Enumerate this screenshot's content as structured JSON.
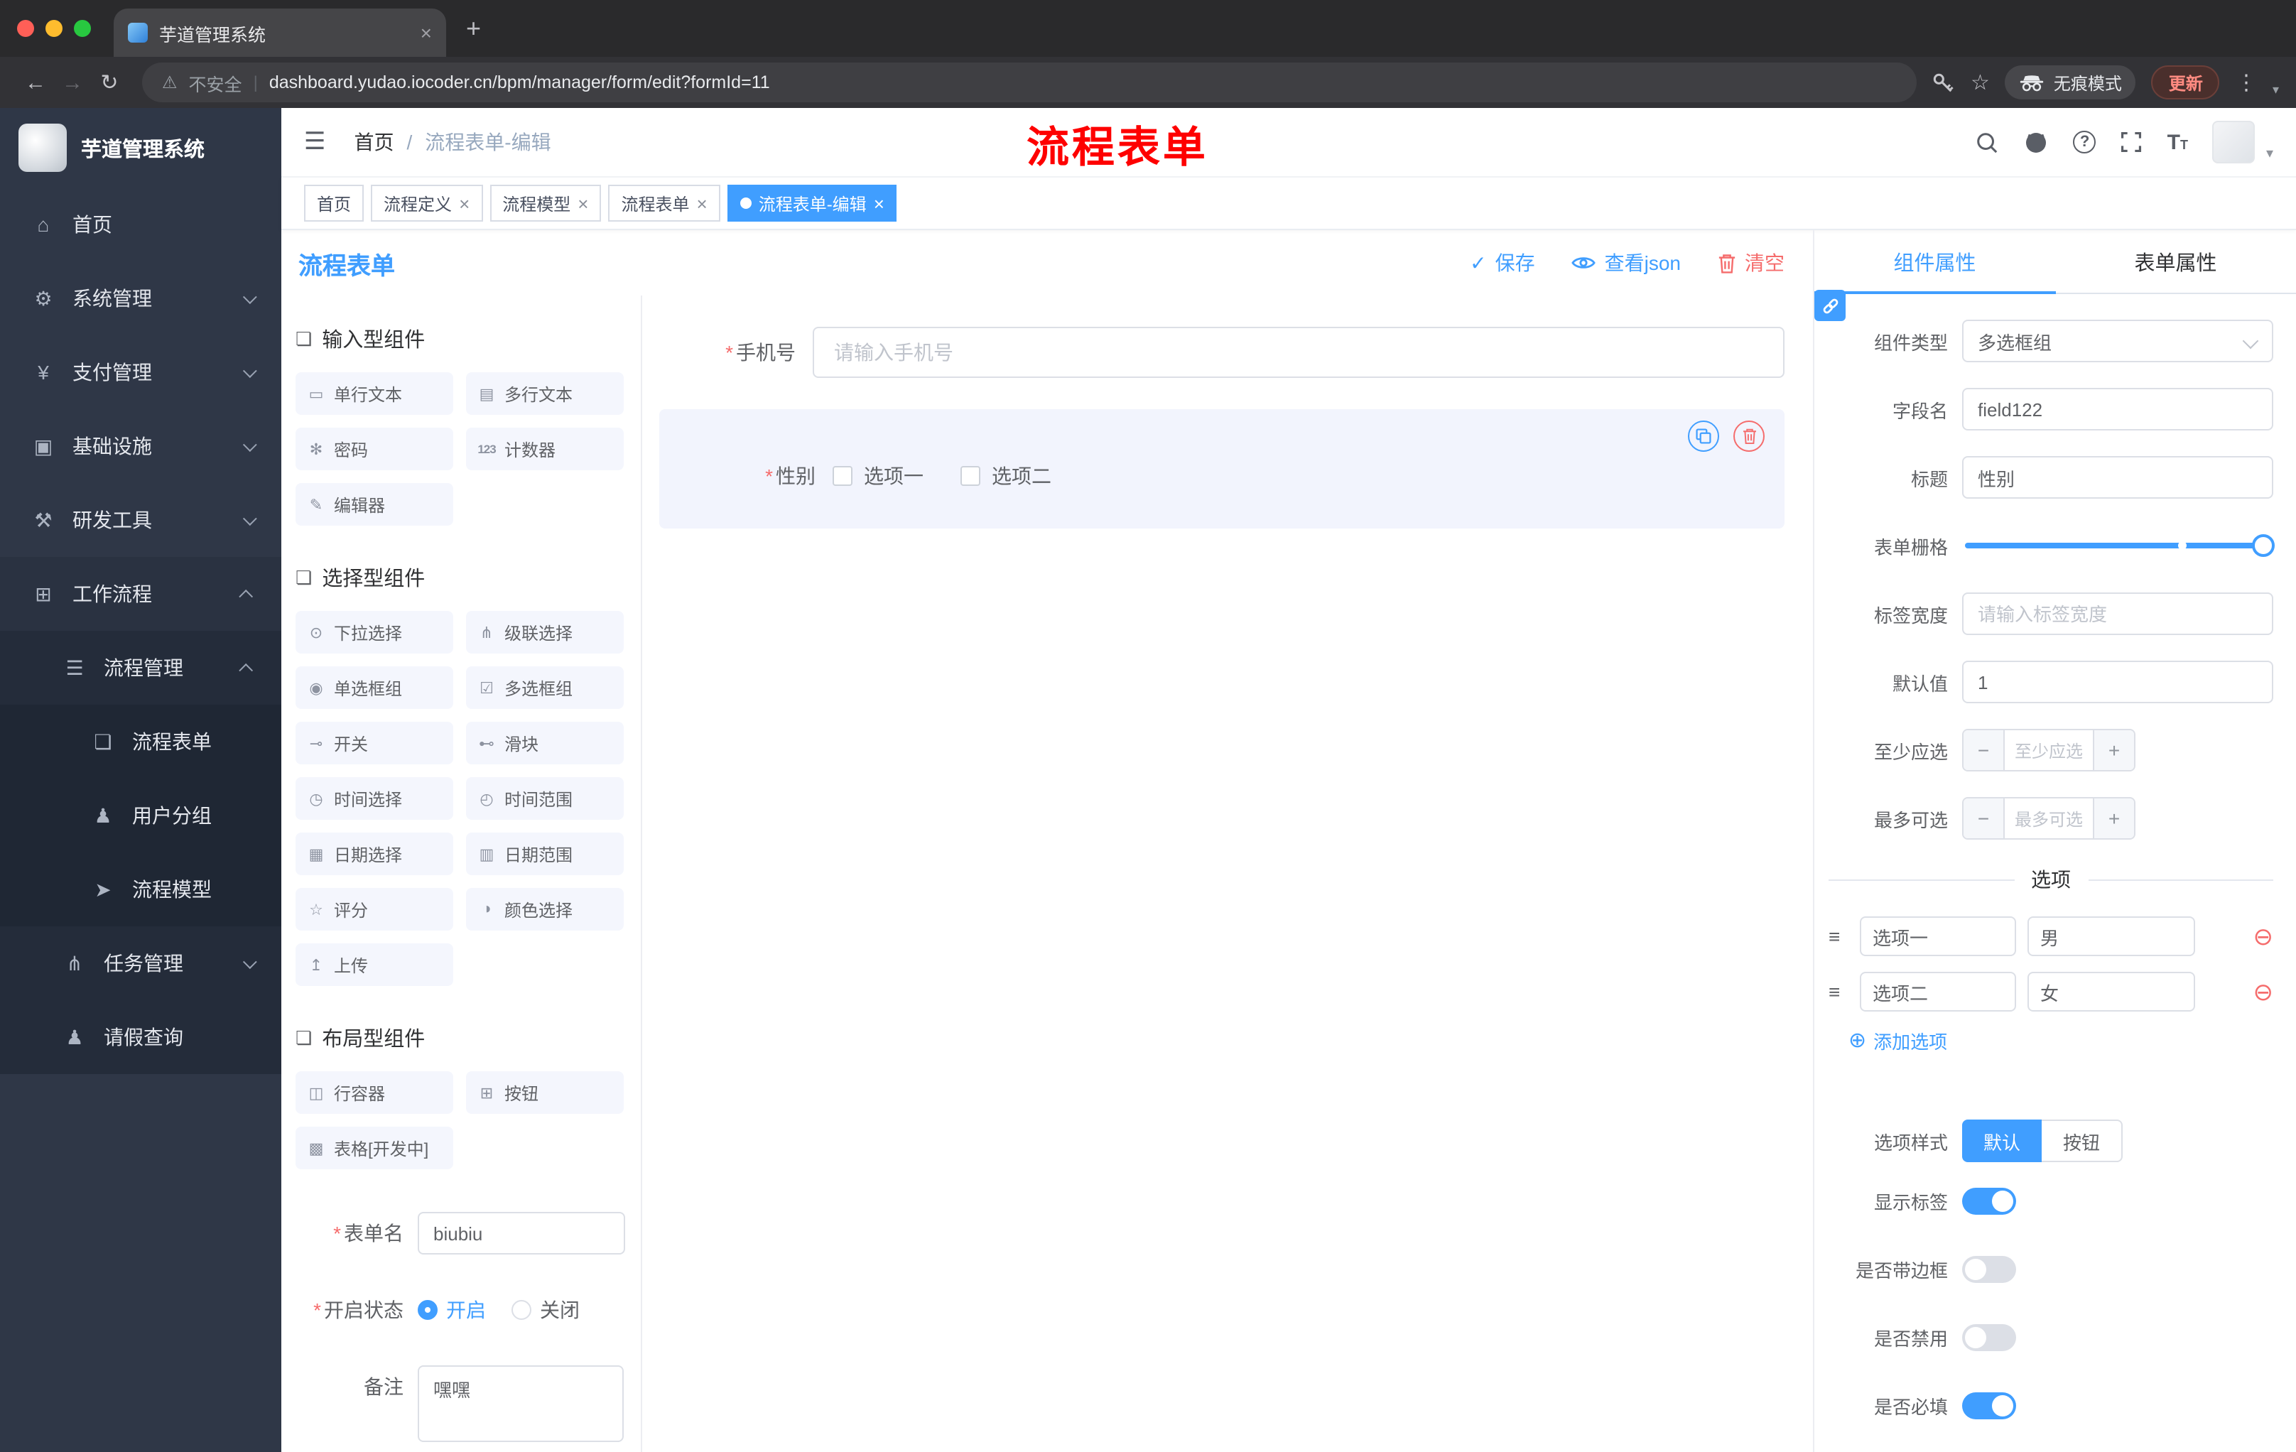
{
  "ui": {
    "close": "×",
    "plus": "+",
    "minus": "−",
    "back": "←",
    "forward": "→",
    "reload": "↻",
    "kebab": "⋮",
    "star": "☆",
    "warning": "⚠",
    "divider": "|",
    "hamburger": "☰",
    "caret": "▾",
    "check": "✓",
    "required": "*",
    "breadcrumb_sep": "/",
    "drag": "≡",
    "remove": "⊖",
    "add": "⊕"
  },
  "colors": {
    "accent": "#409EFF",
    "danger": "#F56C6C",
    "annotation": "#FE0000",
    "sidebar_bg": "#2F3747",
    "tag_active": "#409EFF"
  },
  "browser": {
    "tab_title": "芋道管理系统",
    "security_label": "不安全",
    "url": "dashboard.yudao.iocoder.cn/bpm/manager/form/edit?formId=11",
    "incognito_label": "无痕模式",
    "update_label": "更新"
  },
  "header": {
    "breadcrumb_home": "首页",
    "breadcrumb_current": "流程表单-编辑",
    "annotation": "流程表单"
  },
  "sidebar": {
    "logo_title": "芋道管理系统",
    "items": [
      {
        "label": "首页",
        "icon": "⌂"
      },
      {
        "label": "系统管理",
        "icon": "⚙"
      },
      {
        "label": "支付管理",
        "icon": "¥"
      },
      {
        "label": "基础设施",
        "icon": "▣"
      },
      {
        "label": "研发工具",
        "icon": "⚒"
      },
      {
        "label": "工作流程",
        "icon": "⊞"
      },
      {
        "label": "流程管理",
        "icon": "☰"
      },
      {
        "label": "流程表单",
        "icon": "❏"
      },
      {
        "label": "用户分组",
        "icon": "♟"
      },
      {
        "label": "流程模型",
        "icon": "➤"
      },
      {
        "label": "任务管理",
        "icon": "⋔"
      },
      {
        "label": "请假查询",
        "icon": "♟"
      }
    ]
  },
  "tags": {
    "items": [
      {
        "label": "首页"
      },
      {
        "label": "流程定义"
      },
      {
        "label": "流程模型"
      },
      {
        "label": "流程表单"
      },
      {
        "label": "流程表单-编辑"
      }
    ]
  },
  "page": {
    "title": "流程表单",
    "actions": {
      "save": "保存",
      "view_json": "查看json",
      "clear": "清空"
    }
  },
  "palette": {
    "groups": [
      {
        "title": "输入型组件",
        "icon": "❏",
        "items": [
          {
            "label": "单行文本",
            "icon": "▭"
          },
          {
            "label": "多行文本",
            "icon": "▤"
          },
          {
            "label": "密码",
            "icon": "✻"
          },
          {
            "label": "计数器",
            "icon": "123"
          },
          {
            "label": "编辑器",
            "icon": "✎"
          }
        ]
      },
      {
        "title": "选择型组件",
        "icon": "❏",
        "items": [
          {
            "label": "下拉选择",
            "icon": "⊙"
          },
          {
            "label": "级联选择",
            "icon": "⋔"
          },
          {
            "label": "单选框组",
            "icon": "◉"
          },
          {
            "label": "多选框组",
            "icon": "☑"
          },
          {
            "label": "开关",
            "icon": "⊸"
          },
          {
            "label": "滑块",
            "icon": "⊷"
          },
          {
            "label": "时间选择",
            "icon": "◷"
          },
          {
            "label": "时间范围",
            "icon": "◴"
          },
          {
            "label": "日期选择",
            "icon": "▦"
          },
          {
            "label": "日期范围",
            "icon": "▥"
          },
          {
            "label": "评分",
            "icon": "☆"
          },
          {
            "label": "颜色选择",
            "icon": "◑"
          },
          {
            "label": "上传",
            "icon": "↥"
          }
        ]
      },
      {
        "title": "布局型组件",
        "icon": "❏",
        "items": [
          {
            "label": "行容器",
            "icon": "◫"
          },
          {
            "label": "按钮",
            "icon": "⊞"
          },
          {
            "label": "表格[开发中]",
            "icon": "▩"
          }
        ]
      }
    ]
  },
  "form_settings": {
    "name_label": "表单名",
    "name_value": "biubiu",
    "status_label": "开启状态",
    "status_on": "开启",
    "status_off": "关闭",
    "remark_label": "备注",
    "remark_value": "嘿嘿"
  },
  "canvas": {
    "phone_label": "手机号",
    "phone_placeholder": "请输入手机号",
    "gender_label": "性别",
    "gender_options": [
      "选项一",
      "选项二"
    ]
  },
  "props": {
    "tabs": {
      "component": "组件属性",
      "form": "表单属性"
    },
    "fields": {
      "type_label": "组件类型",
      "type_value": "多选框组",
      "name_label": "字段名",
      "name_value": "field122",
      "title_label": "标题",
      "title_value": "性别",
      "grid_label": "表单栅格",
      "label_width_label": "标签宽度",
      "label_width_placeholder": "请输入标签宽度",
      "default_label": "默认值",
      "default_value": "1",
      "min_label": "至少应选",
      "min_placeholder": "至少应选",
      "max_label": "最多可选",
      "max_placeholder": "最多可选"
    },
    "options_divider": "选项",
    "options": [
      {
        "label": "选项一",
        "value": "男"
      },
      {
        "label": "选项二",
        "value": "女"
      }
    ],
    "add_option_label": "添加选项",
    "style_label": "选项样式",
    "style_default": "默认",
    "style_button": "按钮",
    "switches": [
      {
        "label": "显示标签",
        "on": true
      },
      {
        "label": "是否带边框",
        "on": false
      },
      {
        "label": "是否禁用",
        "on": false
      },
      {
        "label": "是否必填",
        "on": true
      }
    ]
  }
}
